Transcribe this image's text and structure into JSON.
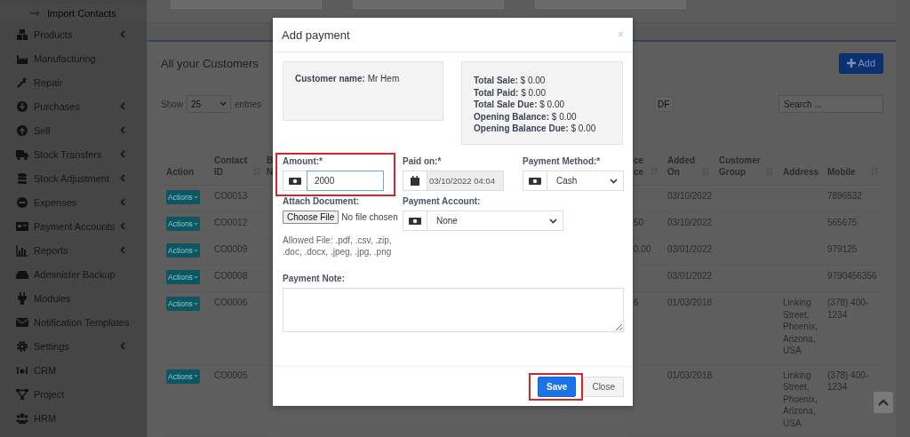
{
  "sidebar": {
    "items": [
      {
        "label": "Import Contacts",
        "kind": "subitem",
        "expandable": false
      },
      {
        "label": "Products",
        "kind": "item",
        "expandable": true
      },
      {
        "label": "Manufacturing",
        "kind": "item",
        "expandable": false
      },
      {
        "label": "Repair",
        "kind": "item",
        "expandable": false
      },
      {
        "label": "Purchases",
        "kind": "item",
        "expandable": true
      },
      {
        "label": "Sell",
        "kind": "item",
        "expandable": true
      },
      {
        "label": "Stock Transfers",
        "kind": "item",
        "expandable": true
      },
      {
        "label": "Stock Adjustment",
        "kind": "item",
        "expandable": true
      },
      {
        "label": "Expenses",
        "kind": "item",
        "expandable": true
      },
      {
        "label": "Payment Accounts",
        "kind": "item",
        "expandable": true
      },
      {
        "label": "Reports",
        "kind": "item",
        "expandable": true
      },
      {
        "label": "Administer Backup",
        "kind": "item",
        "expandable": false
      },
      {
        "label": "Modules",
        "kind": "item",
        "expandable": false
      },
      {
        "label": "Notification Templates",
        "kind": "item",
        "expandable": false
      },
      {
        "label": "Settings",
        "kind": "item",
        "expandable": true
      },
      {
        "label": "CRM",
        "kind": "item",
        "expandable": false
      },
      {
        "label": "Project",
        "kind": "item",
        "expandable": false
      },
      {
        "label": "HRM",
        "kind": "item",
        "expandable": false
      }
    ]
  },
  "customers": {
    "title": "All your Customers",
    "add_button": "Add",
    "length_menu": {
      "prefix": "Show",
      "value": "25",
      "suffix": "entries"
    },
    "export_button": "DF",
    "search": {
      "placeholder": "Search ..."
    },
    "table": {
      "columns": [
        {
          "label": "Action",
          "sortable": false
        },
        {
          "label": "Contact ID",
          "sortable": true
        },
        {
          "label": "B N",
          "sortable": false
        },
        {
          "label": "ce ce",
          "sortable": true
        },
        {
          "label": "Added On",
          "sortable": true
        },
        {
          "label": "Customer Group",
          "sortable": true
        },
        {
          "label": "Address",
          "sortable": false
        },
        {
          "label": "Mobile",
          "sortable": true
        }
      ],
      "rows": [
        {
          "action": "Actions",
          "contact_id": "CO0013",
          "added_on": "03/10/2022",
          "mobile": "7896532"
        },
        {
          "action": "Actions",
          "contact_id": "CO0012",
          "column_4": "50",
          "added_on": "03/10/2022",
          "mobile": "565675"
        },
        {
          "action": "Actions",
          "contact_id": "CO0009",
          "column_4": "0.00",
          "added_on": "03/01/2022",
          "mobile": "979125"
        },
        {
          "action": "Actions",
          "contact_id": "CO0008",
          "added_on": "03/01/2022",
          "mobile": "9790456356"
        },
        {
          "action": "Actions",
          "contact_id": "CO0006",
          "column_4": "6",
          "added_on": "01/03/2018",
          "address": "Linking Street, Phoenix, Arizona, USA",
          "mobile": "(378) 400-1234"
        },
        {
          "action": "Actions",
          "contact_id": "CO0005",
          "added_on": "01/03/2018",
          "address": "Linking Street, Phoenix, Arizona, USA",
          "mobile": "(378) 400-1234"
        }
      ]
    }
  },
  "modal": {
    "title": "Add payment",
    "close": "×",
    "customer": "**Customer name:** Mr Hem",
    "totals": [
      "**Total Sale:** $ 0.00",
      "**Total Paid:** $ 0.00",
      "**Total Sale Due:** $ 0.00",
      "**Opening Balance:** $ 0.00",
      "**Opening Balance Due:** $ 0.00"
    ],
    "fields": [
      {
        "kind": "amount",
        "label": "Amount:*",
        "value": "2000",
        "focused": true,
        "highlighted": true
      },
      {
        "kind": "date",
        "label": "Paid on:*",
        "value": "03/10/2022 04:04",
        "readonly": true
      },
      {
        "kind": "select",
        "label": "Payment Method:*",
        "value": "Cash"
      },
      {
        "kind": "file",
        "label": "Attach Document:",
        "button": "Choose File",
        "status": "No file chosen",
        "help": "Allowed File: .pdf, .csv, .zip, .doc, .docx, .jpeg, .jpg, .png"
      },
      {
        "kind": "select",
        "label": "Payment Account:",
        "value": "None",
        "wide": true
      },
      {
        "kind": "textarea",
        "label": "Payment Note:"
      }
    ],
    "buttons": [
      {
        "label": "Save",
        "kind": "primary",
        "highlighted": true
      },
      {
        "label": "Close",
        "kind": "default",
        "highlighted": false
      }
    ]
  }
}
